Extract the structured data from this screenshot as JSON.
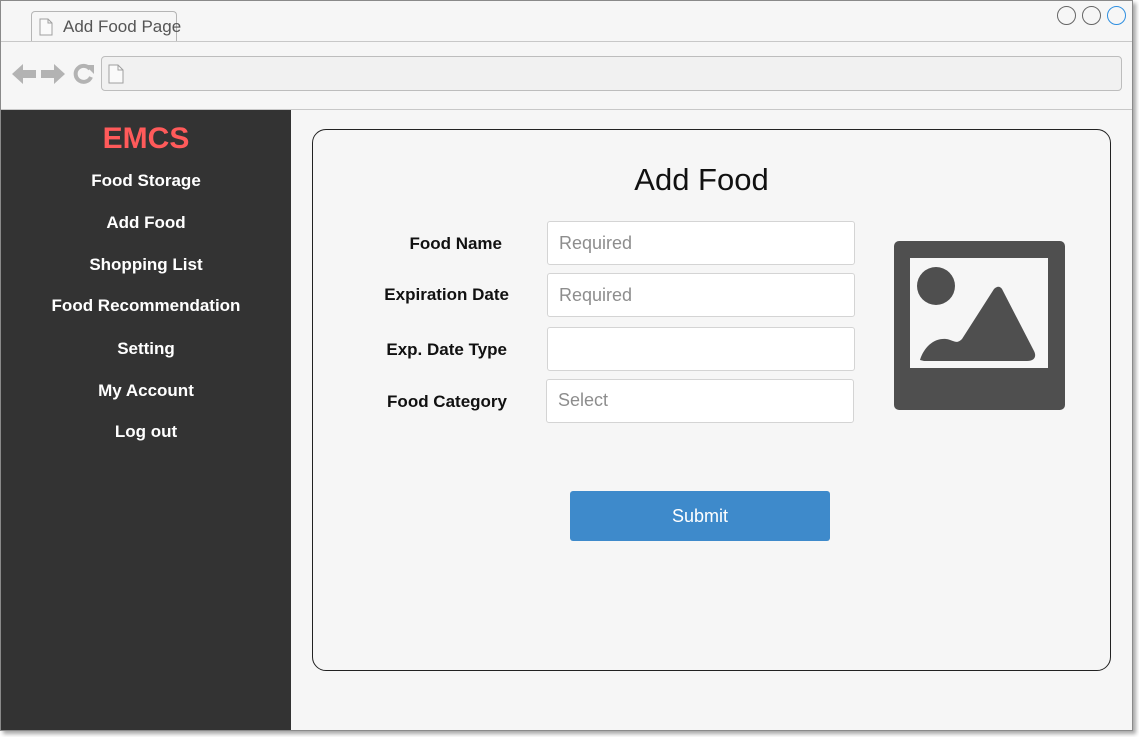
{
  "browser": {
    "tab_title": "Add Food Page",
    "window_buttons": [
      "minimize",
      "maximize",
      "close"
    ],
    "icons": {
      "back": "arrow-left-icon",
      "forward": "arrow-right-icon",
      "reload": "reload-icon",
      "page": "document-icon"
    },
    "address": ""
  },
  "sidebar": {
    "brand": "EMCS",
    "brand_color": "#ff5a5a",
    "background": "#333333",
    "items": [
      {
        "label": "Food Storage"
      },
      {
        "label": "Add Food"
      },
      {
        "label": "Shopping List"
      },
      {
        "label": "Food Recommendation"
      },
      {
        "label": "Setting"
      },
      {
        "label": "My Account"
      },
      {
        "label": "Log out"
      }
    ]
  },
  "form": {
    "title": "Add Food",
    "fields": {
      "food_name": {
        "label": "Food Name",
        "placeholder": "Required",
        "value": ""
      },
      "expiration_date": {
        "label": "Expiration Date",
        "placeholder": "Required",
        "value": ""
      },
      "exp_date_type": {
        "label": "Exp. Date Type",
        "placeholder": "",
        "value": ""
      },
      "food_category": {
        "label": "Food Category",
        "value": "Select"
      }
    },
    "image_icon": "image-placeholder-icon",
    "submit_label": "Submit",
    "submit_color": "#3e8acb"
  }
}
